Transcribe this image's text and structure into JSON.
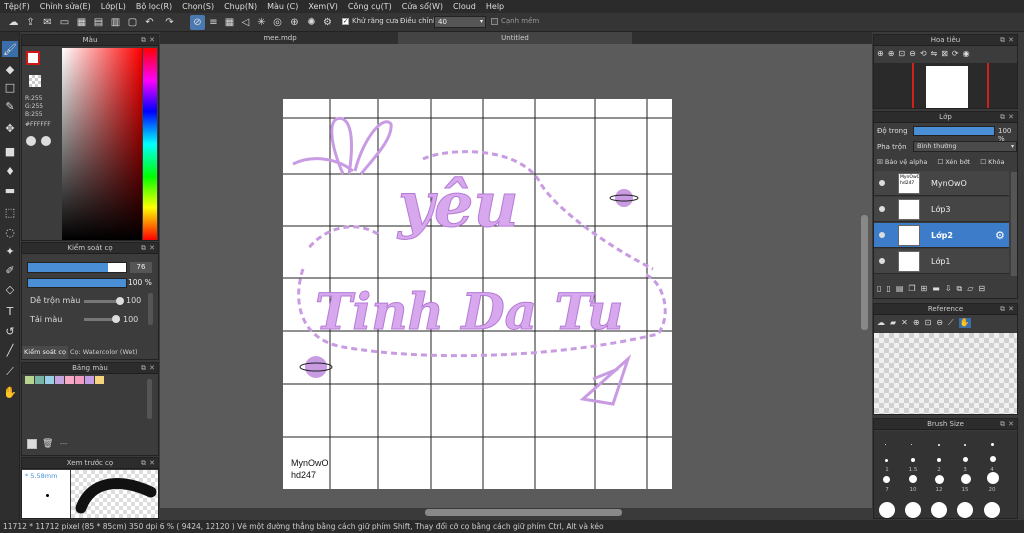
{
  "menu": [
    "Tệp(F)",
    "Chỉnh sửa(E)",
    "Lớp(L)",
    "Bộ lọc(R)",
    "Chọn(S)",
    "Chụp(N)",
    "Màu (C)",
    "Xem(V)",
    "Công cụ(T)",
    "Cửa sổ(W)",
    "Cloud",
    "Help"
  ],
  "toolbar": {
    "antialias_label": "Khử răng cưa",
    "adjust_label": "Điều chỉnh",
    "adjust_value": "40",
    "edge_label": "Cạnh mềm"
  },
  "tabs": [
    "mee.mdp",
    "Untitled"
  ],
  "color_panel": {
    "title": "Màu",
    "r": "R:255",
    "g": "G:255",
    "b": "B:255",
    "hex": "#FFFFFF"
  },
  "brush_control": {
    "title": "Kiểm soát cọ",
    "size_value": "76",
    "opacity_value": "100 %",
    "mix_label": "Dễ trộn màu",
    "mix_value": "100",
    "reload_label": "Tải màu",
    "reload_value": "100",
    "tab_label": "Kiểm soát cọ",
    "brush_name": "Cọ: Watercolor (Wet)"
  },
  "palette": {
    "title": "Bảng màu",
    "swatches": [
      "#b7d58f",
      "#78b5a3",
      "#9ad0e6",
      "#c5a5e0",
      "#f7a9c5",
      "#f19cc0",
      "#c39ee6",
      "#f6d37e"
    ],
    "footer_text": "---"
  },
  "preview": {
    "title": "Xem trước cọ",
    "size": "* 5.58mm"
  },
  "navigator": {
    "title": "Hoa tiêu"
  },
  "layers_panel": {
    "title": "Lớp",
    "opacity_label": "Độ trong",
    "opacity_value": "100 %",
    "blend_label": "Pha trộn",
    "blend_value": "Bình thường",
    "protect_alpha": "Bảo vệ alpha",
    "clip": "Xén bớt",
    "lock": "Khóa",
    "layers": [
      {
        "name": "MynOwO",
        "thumb_text": "MynOwO hd247",
        "active": false
      },
      {
        "name": "Lớp3",
        "active": false
      },
      {
        "name": "Lớp2",
        "active": true
      },
      {
        "name": "Lớp1",
        "active": false
      }
    ]
  },
  "reference": {
    "title": "Reference"
  },
  "brush_size": {
    "title": "Brush Size",
    "labels": [
      "1",
      "1.5",
      "2",
      "3",
      "4",
      "7",
      "10",
      "12",
      "15",
      "20"
    ]
  },
  "canvas": {
    "word1": "yêu",
    "word2": "Tinh Da Tu",
    "signature_line1": "MynOwO",
    "signature_line2": "hd247"
  },
  "status": "11712 * 11712 pixel  (85 * 85cm)  350 dpi  6 %  ( 9424, 12120 )  Vẽ một đường thẳng bằng cách giữ phím Shift, Thay đổi cỡ cọ bằng cách giữ phím Ctrl, Alt và kéo",
  "colors": {
    "accent": "#3d7cc9",
    "lilac": "#c89be3"
  }
}
